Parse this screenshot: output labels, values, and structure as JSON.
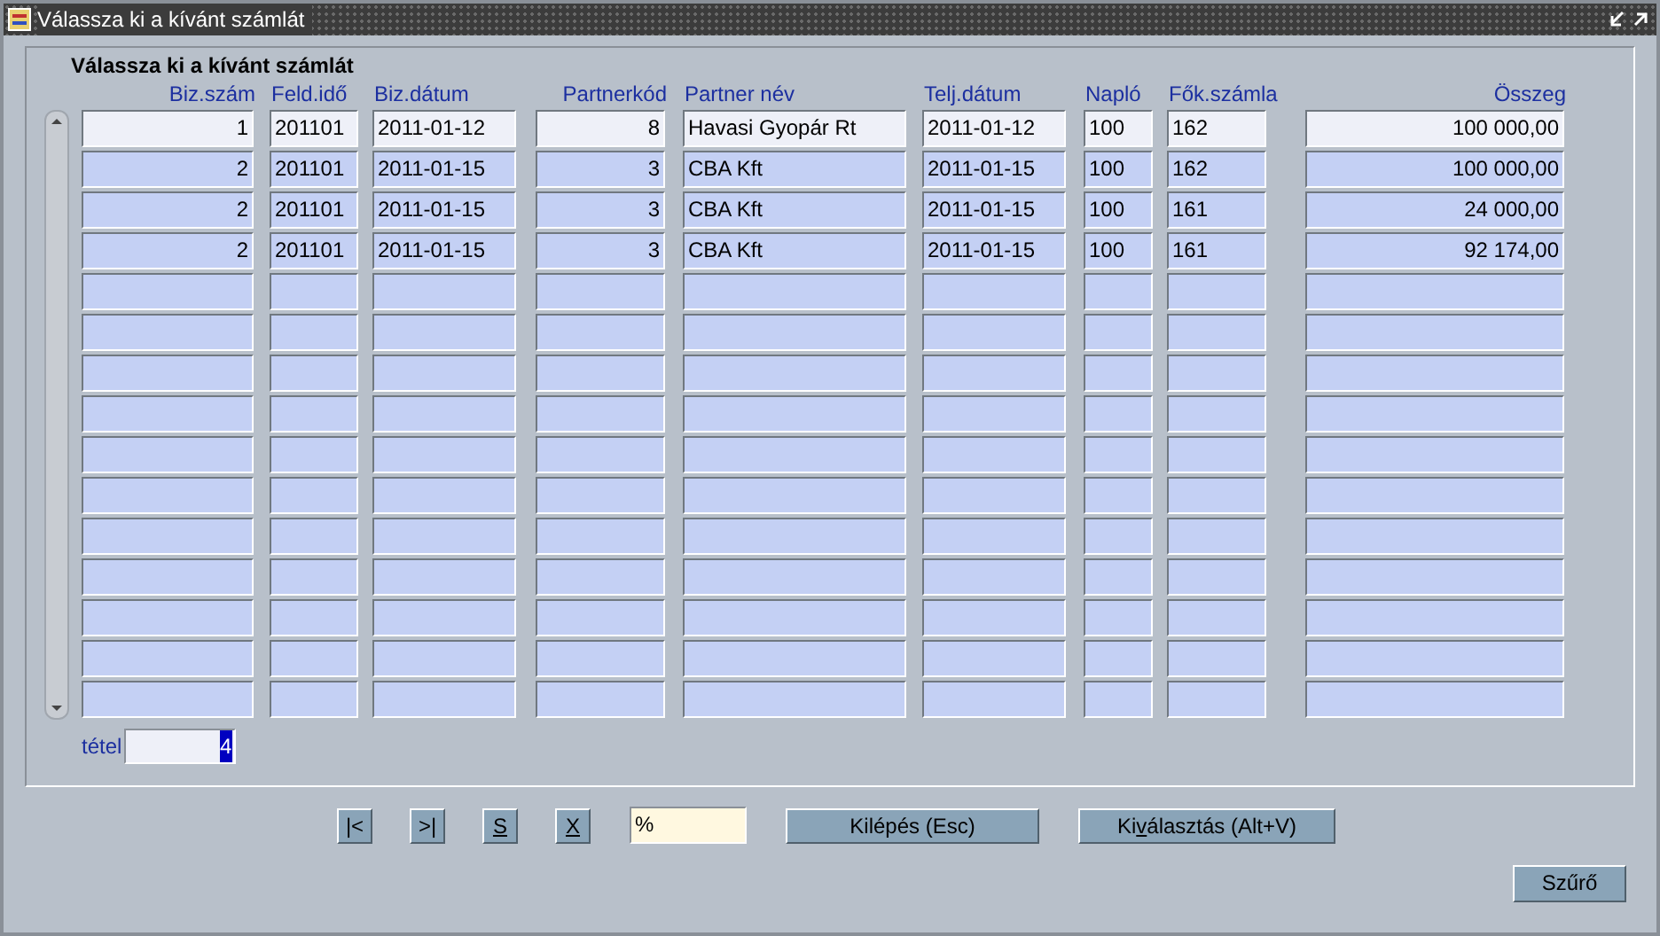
{
  "window": {
    "title": "Válassza ki a kívánt számlát"
  },
  "heading": "Válassza ki a kívánt számlát",
  "table": {
    "columns": [
      "Biz.szám",
      "Feld.idő",
      "Biz.dátum",
      "Partnerkód",
      "Partner név",
      "Telj.dátum",
      "Napló",
      "Fők.számla",
      "Összeg"
    ],
    "rows": [
      {
        "selected": true,
        "cells": [
          "1",
          "201101",
          "2011-01-12",
          "8",
          "Havasi Gyopár Rt",
          "2011-01-12",
          "100",
          "162",
          "100 000,00"
        ]
      },
      {
        "selected": false,
        "cells": [
          "2",
          "201101",
          "2011-01-15",
          "3",
          "CBA Kft",
          "2011-01-15",
          "100",
          "162",
          "100 000,00"
        ]
      },
      {
        "selected": false,
        "cells": [
          "2",
          "201101",
          "2011-01-15",
          "3",
          "CBA Kft",
          "2011-01-15",
          "100",
          "161",
          "24 000,00"
        ]
      },
      {
        "selected": false,
        "cells": [
          "2",
          "201101",
          "2011-01-15",
          "3",
          "CBA Kft",
          "2011-01-15",
          "100",
          "161",
          "92 174,00"
        ]
      }
    ]
  },
  "count": {
    "label": "tétel",
    "value": "4",
    "value_selected": true
  },
  "nav_buttons": [
    {
      "label": "|<"
    },
    {
      "label": ">|"
    },
    {
      "underlined": "S"
    },
    {
      "underlined": "X"
    }
  ],
  "filter_field": {
    "value": "%"
  },
  "action_buttons": [
    {
      "label": "Kilépés (Esc)"
    },
    {
      "label": "Ki",
      "underlined": "v",
      "label_end": "álasztás (Alt+V)"
    }
  ],
  "filter_button": {
    "label": "Szűrő"
  }
}
